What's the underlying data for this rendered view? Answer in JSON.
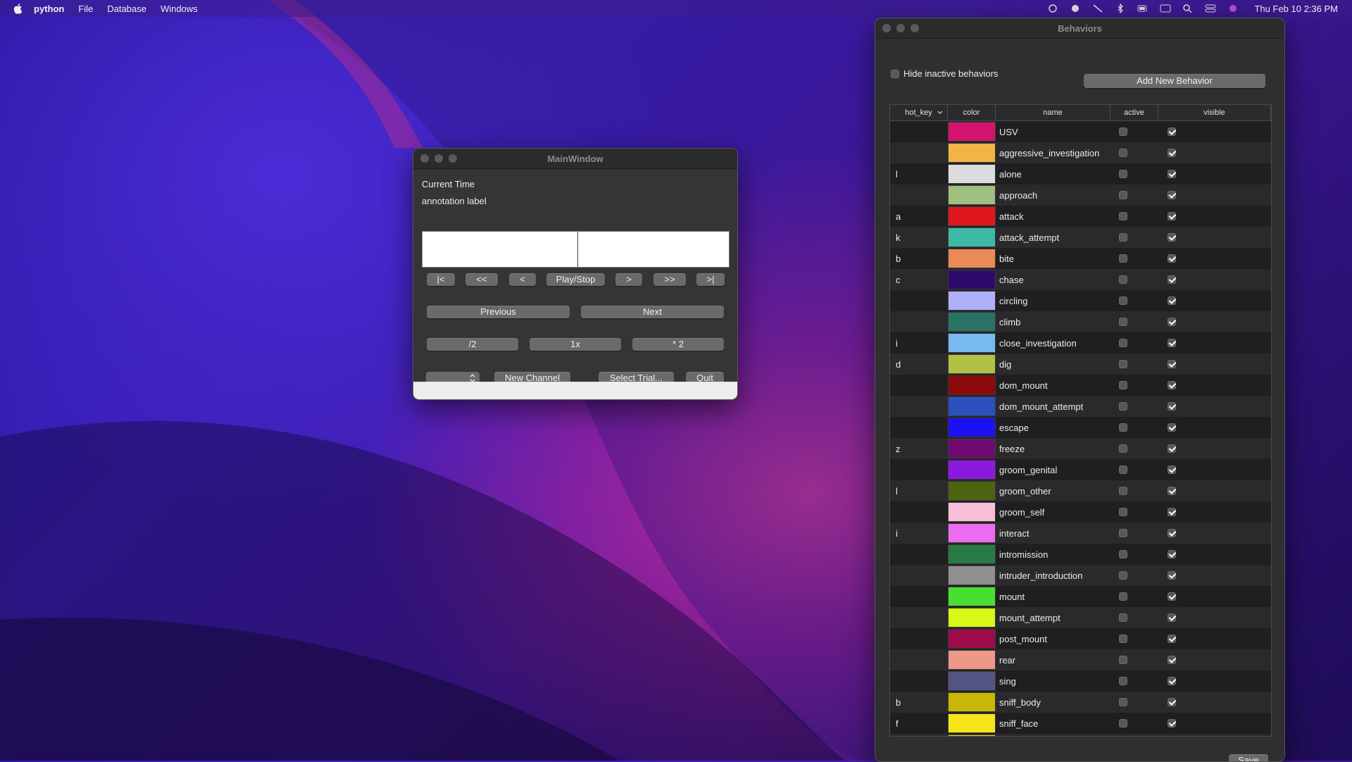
{
  "menubar": {
    "app": "python",
    "items": [
      "File",
      "Database",
      "Windows"
    ],
    "clock": "Thu Feb 10  2:36 PM"
  },
  "main_window": {
    "title": "MainWindow",
    "current_time_label": "Current Time",
    "annotation_label": "annotation label",
    "transport": [
      "|<",
      "<<",
      "<",
      "Play/Stop",
      ">",
      ">>",
      ">|"
    ],
    "previous": "Previous",
    "next": "Next",
    "speed": [
      "/2",
      "1x",
      "* 2"
    ],
    "new_channel": "New Channel",
    "select_trial": "Select Trial...",
    "quit": "Quit"
  },
  "behaviors_window": {
    "title": "Behaviors",
    "hide_inactive_label": "Hide inactive behaviors",
    "hide_inactive_checked": false,
    "add_button": "Add New Behavior",
    "save_button": "Save",
    "columns": [
      "hot_key",
      "color",
      "name",
      "active",
      "visible"
    ],
    "rows": [
      {
        "hot_key": "",
        "color": "#d3136e",
        "name": "USV",
        "active": false,
        "visible": true
      },
      {
        "hot_key": "",
        "color": "#f3b444",
        "name": "aggressive_investigation",
        "active": false,
        "visible": true
      },
      {
        "hot_key": "l",
        "color": "#dcdcdc",
        "name": "alone",
        "active": false,
        "visible": true
      },
      {
        "hot_key": "",
        "color": "#a0c080",
        "name": "approach",
        "active": false,
        "visible": true
      },
      {
        "hot_key": "a",
        "color": "#e0161e",
        "name": "attack",
        "active": false,
        "visible": true
      },
      {
        "hot_key": "k",
        "color": "#3cbaa6",
        "name": "attack_attempt",
        "active": false,
        "visible": true
      },
      {
        "hot_key": "b",
        "color": "#ea8a58",
        "name": "bite",
        "active": false,
        "visible": true
      },
      {
        "hot_key": "c",
        "color": "#2c0a6c",
        "name": "chase",
        "active": false,
        "visible": true
      },
      {
        "hot_key": "",
        "color": "#b0b0fa",
        "name": "circling",
        "active": false,
        "visible": true
      },
      {
        "hot_key": "",
        "color": "#2a7264",
        "name": "climb",
        "active": false,
        "visible": true
      },
      {
        "hot_key": "i",
        "color": "#78baf0",
        "name": "close_investigation",
        "active": false,
        "visible": true
      },
      {
        "hot_key": "d",
        "color": "#b2c044",
        "name": "dig",
        "active": false,
        "visible": true
      },
      {
        "hot_key": "",
        "color": "#8c0a0a",
        "name": "dom_mount",
        "active": false,
        "visible": true
      },
      {
        "hot_key": "",
        "color": "#2a50c0",
        "name": "dom_mount_attempt",
        "active": false,
        "visible": true
      },
      {
        "hot_key": "",
        "color": "#1a10f0",
        "name": "escape",
        "active": false,
        "visible": true
      },
      {
        "hot_key": "z",
        "color": "#6e0a72",
        "name": "freeze",
        "active": false,
        "visible": true
      },
      {
        "hot_key": "",
        "color": "#8c18e0",
        "name": "groom_genital",
        "active": false,
        "visible": true
      },
      {
        "hot_key": "l",
        "color": "#4c6410",
        "name": "groom_other",
        "active": false,
        "visible": true
      },
      {
        "hot_key": "",
        "color": "#f8c0d8",
        "name": "groom_self",
        "active": false,
        "visible": true
      },
      {
        "hot_key": "i",
        "color": "#ec6cf0",
        "name": "interact",
        "active": false,
        "visible": true
      },
      {
        "hot_key": "",
        "color": "#287a44",
        "name": "intromission",
        "active": false,
        "visible": true
      },
      {
        "hot_key": "",
        "color": "#909090",
        "name": "intruder_introduction",
        "active": false,
        "visible": true
      },
      {
        "hot_key": "",
        "color": "#48e030",
        "name": "mount",
        "active": false,
        "visible": true
      },
      {
        "hot_key": "",
        "color": "#d8f818",
        "name": "mount_attempt",
        "active": false,
        "visible": true
      },
      {
        "hot_key": "",
        "color": "#9c0c4a",
        "name": "post_mount",
        "active": false,
        "visible": true
      },
      {
        "hot_key": "",
        "color": "#ee9888",
        "name": "rear",
        "active": false,
        "visible": true
      },
      {
        "hot_key": "",
        "color": "#545484",
        "name": "sing",
        "active": false,
        "visible": true
      },
      {
        "hot_key": "b",
        "color": "#c8b608",
        "name": "sniff_body",
        "active": false,
        "visible": true
      },
      {
        "hot_key": "f",
        "color": "#f6e41a",
        "name": "sniff_face",
        "active": false,
        "visible": true
      },
      {
        "hot_key": "",
        "color": "#e8dc14",
        "name": "",
        "active": false,
        "visible": true
      }
    ]
  }
}
